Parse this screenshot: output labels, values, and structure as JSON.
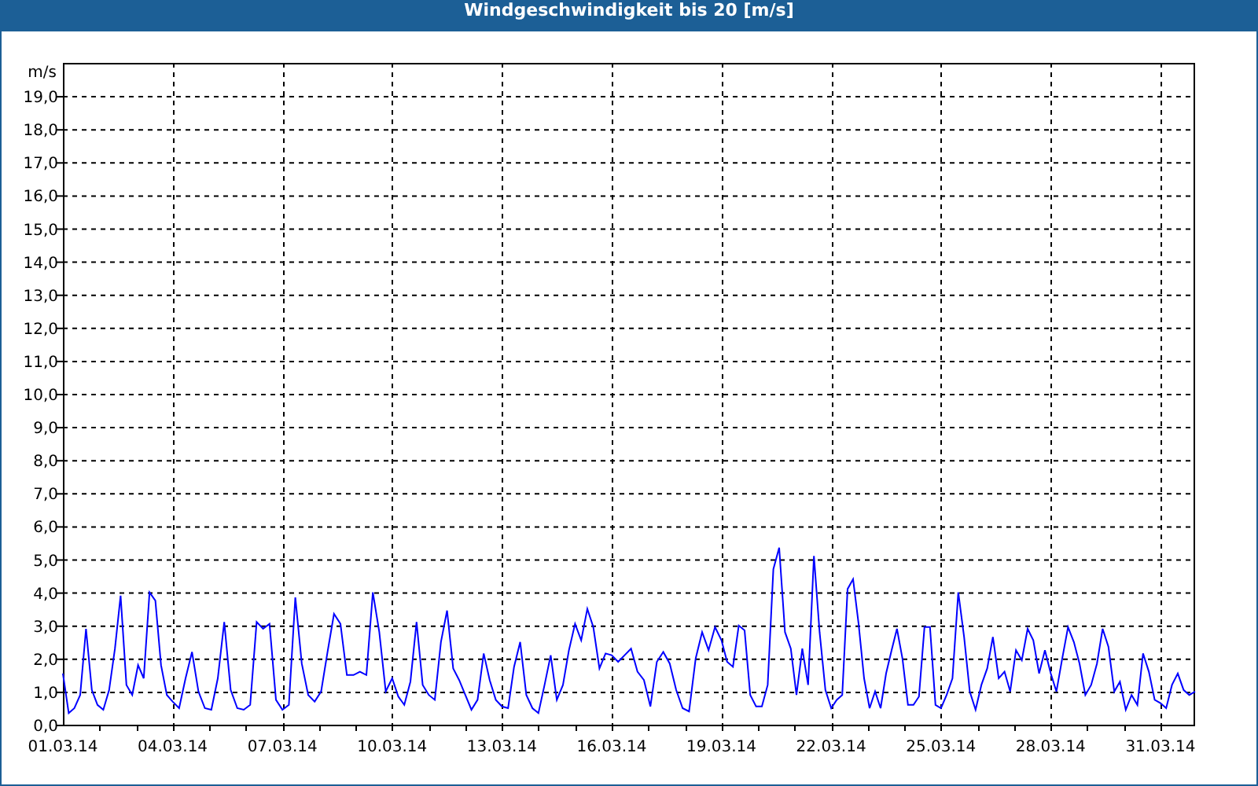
{
  "chart_data": {
    "type": "line",
    "title": "Windgeschwindigkeit bis 20 [m/s]",
    "ylabel": "m/s",
    "categories": [
      "01.03.14",
      null,
      null,
      null,
      null,
      null,
      null,
      null,
      null,
      null,
      null,
      null,
      null,
      null,
      null,
      null,
      null,
      null,
      null,
      "04.03.14",
      null,
      null,
      null,
      null,
      null,
      null,
      null,
      null,
      null,
      null,
      null,
      null,
      null,
      null,
      null,
      null,
      "07.03.14",
      null,
      null,
      null,
      null,
      null,
      null,
      null,
      null,
      null,
      null,
      null,
      null,
      null,
      null,
      null,
      null,
      "10.03.14",
      null,
      null,
      null,
      null,
      null,
      null,
      null,
      null,
      null,
      null,
      null,
      null,
      null,
      null,
      null,
      null,
      null,
      "13.03.14",
      null,
      null,
      null,
      null,
      null,
      null,
      null,
      null,
      null,
      null,
      null,
      null,
      null,
      null,
      null,
      null,
      null,
      "16.03.14",
      null,
      null,
      null,
      null,
      null,
      null,
      null,
      null,
      null,
      null,
      null,
      null,
      null,
      null,
      null,
      null,
      "19.03.14",
      null,
      null,
      null,
      null,
      null,
      null,
      null,
      null,
      null,
      null,
      null,
      null,
      null,
      null,
      null,
      null,
      null,
      null,
      "22.03.14",
      null,
      null,
      null,
      null,
      null,
      null,
      null,
      null,
      null,
      null,
      null,
      null,
      null,
      null,
      null,
      null,
      null,
      null,
      null,
      "25.03.14",
      null,
      null,
      null,
      null,
      null,
      null,
      null,
      null,
      null,
      null,
      null,
      null,
      null,
      null,
      null,
      null,
      null,
      null,
      "28.03.14",
      null,
      null,
      null,
      null,
      null,
      null,
      null,
      null,
      null,
      null,
      null,
      null,
      null,
      null,
      null,
      null,
      null,
      null,
      "31.03.14",
      null,
      null,
      null,
      null,
      null,
      null
    ],
    "series": [
      {
        "color": "#0000ff",
        "values": [
          1.55,
          0.35,
          0.5,
          0.9,
          2.9,
          1.05,
          0.6,
          0.45,
          1.05,
          2.3,
          3.9,
          1.2,
          0.9,
          1.8,
          1.4,
          4.0,
          3.75,
          1.8,
          0.9,
          0.7,
          0.5,
          1.4,
          2.2,
          1.0,
          0.5,
          0.45,
          1.4,
          3.1,
          1.05,
          0.5,
          0.45,
          0.6,
          3.1,
          2.9,
          3.05,
          0.75,
          0.45,
          0.6,
          3.85,
          1.85,
          0.9,
          0.7,
          1.0,
          2.2,
          3.35,
          3.05,
          1.5,
          1.5,
          1.6,
          1.5,
          4.0,
          2.8,
          1.0,
          1.4,
          0.85,
          0.6,
          1.3,
          3.1,
          1.2,
          0.9,
          0.75,
          2.5,
          3.45,
          1.7,
          1.35,
          0.9,
          0.45,
          0.75,
          2.15,
          1.35,
          0.75,
          0.55,
          0.5,
          1.75,
          2.5,
          0.9,
          0.5,
          0.35,
          1.2,
          2.1,
          0.75,
          1.2,
          2.25,
          3.05,
          2.55,
          3.5,
          2.95,
          1.7,
          2.15,
          2.1,
          1.9,
          2.1,
          2.3,
          1.6,
          1.35,
          0.55,
          1.9,
          2.2,
          1.85,
          1.05,
          0.5,
          0.4,
          2.0,
          2.8,
          2.25,
          2.95,
          2.55,
          1.9,
          1.75,
          3.0,
          2.85,
          0.9,
          0.55,
          0.55,
          1.2,
          4.7,
          5.35,
          2.8,
          2.3,
          0.9,
          2.3,
          1.2,
          5.1,
          2.8,
          1.05,
          0.5,
          0.75,
          0.9,
          4.1,
          4.4,
          3.05,
          1.4,
          0.5,
          1.0,
          0.5,
          1.55,
          2.25,
          2.9,
          2.0,
          0.6,
          0.6,
          0.85,
          2.95,
          2.95,
          0.6,
          0.5,
          0.9,
          1.4,
          4.0,
          2.65,
          1.0,
          0.45,
          1.2,
          1.7,
          2.65,
          1.4,
          1.6,
          1.0,
          2.25,
          1.95,
          2.9,
          2.55,
          1.55,
          2.25,
          1.55,
          1.0,
          2.0,
          2.95,
          2.5,
          1.85,
          0.9,
          1.2,
          1.85,
          2.9,
          2.35,
          1.0,
          1.3,
          0.45,
          0.9,
          0.6,
          2.15,
          1.6,
          0.75,
          0.65,
          0.5,
          1.2,
          1.55,
          1.05,
          0.9,
          1.0
        ]
      }
    ],
    "ylim": [
      0,
      20
    ],
    "grid": true,
    "yticks": [
      {
        "value": 0,
        "label": "0,0"
      },
      {
        "value": 1,
        "label": "1,0"
      },
      {
        "value": 2,
        "label": "2,0"
      },
      {
        "value": 3,
        "label": "3,0"
      },
      {
        "value": 4,
        "label": "4,0"
      },
      {
        "value": 5,
        "label": "5,0"
      },
      {
        "value": 6,
        "label": "6,0"
      },
      {
        "value": 7,
        "label": "7,0"
      },
      {
        "value": 8,
        "label": "8,0"
      },
      {
        "value": 9,
        "label": "9,0"
      },
      {
        "value": 10,
        "label": "10,0"
      },
      {
        "value": 11,
        "label": "11,0"
      },
      {
        "value": 12,
        "label": "12,0"
      },
      {
        "value": 13,
        "label": "13,0"
      },
      {
        "value": 14,
        "label": "14,0"
      },
      {
        "value": 15,
        "label": "15,0"
      },
      {
        "value": 16,
        "label": "16,0"
      },
      {
        "value": 17,
        "label": "17,0"
      },
      {
        "value": 18,
        "label": "18,0"
      },
      {
        "value": 19,
        "label": "19,0"
      }
    ]
  }
}
